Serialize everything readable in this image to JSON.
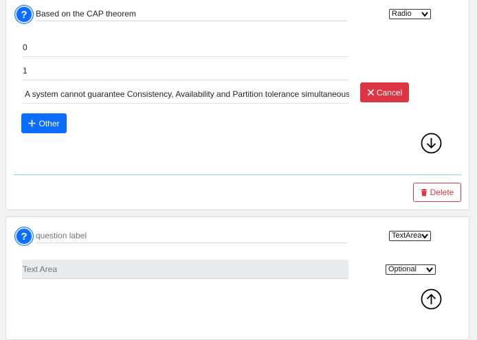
{
  "question1": {
    "label": "Based on the CAP theorem",
    "type_select": "Radio",
    "options": [
      "0",
      "1",
      "A system cannot guarantee Consistency, Availability and Partition tolerance simultaneously"
    ],
    "cancel_label": "Cancel",
    "other_label": "Other",
    "delete_label": "Delete"
  },
  "question2": {
    "placeholder": "question label",
    "type_select": "TextArea",
    "preview_text": "Text Area",
    "required_select": "Optional"
  },
  "colors": {
    "primary": "#0d6efd",
    "danger": "#dc3545"
  },
  "icons": [
    "question-icon",
    "x-icon",
    "plus-icon",
    "arrow-down-circle-icon",
    "trash-icon",
    "arrow-up-circle-icon",
    "chevron-down-icon"
  ]
}
